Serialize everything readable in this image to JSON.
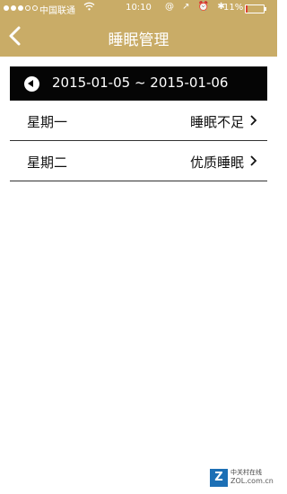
{
  "status_bar": {
    "carrier": "中国联通",
    "wifi_icon": "wifi-icon",
    "time": "10:10",
    "indicator_icons": "@ ↗ ⏰ ✱",
    "battery_percent": "11%",
    "battery_level": 0.11,
    "battery_color": "#dd4433"
  },
  "nav": {
    "title": "睡眠管理",
    "back_icon": "chevron-left-icon",
    "bar_color": "#c9ac67"
  },
  "date_bar": {
    "prev_icon": "circle-left-arrow-icon",
    "range": "2015-01-05 ~ 2015-01-06"
  },
  "rows": [
    {
      "day": "星期一",
      "status": "睡眠不足"
    },
    {
      "day": "星期二",
      "status": "优质睡眠"
    }
  ],
  "watermark": {
    "logo_letter": "Z",
    "cn": "中关村在线",
    "en": "ZOL.com.cn"
  }
}
